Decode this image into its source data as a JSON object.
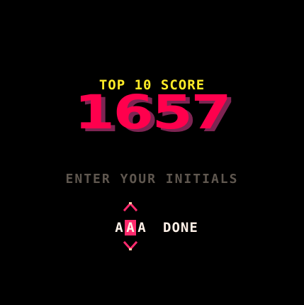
{
  "colors": {
    "background": "#000000",
    "title_yellow": "#ffec27",
    "score_pink": "#ff004d",
    "score_shadow": "#7e2553",
    "score_highlight": "#ffccaa",
    "prompt_gray": "#5f574f",
    "white": "#fff1e8",
    "cursor_pink": "#ff2a6d"
  },
  "header": {
    "subtitle": "TOP 10 SCORE",
    "score": "1657"
  },
  "entry": {
    "prompt": "ENTER YOUR INITIALS",
    "initials": [
      "A",
      "A",
      "A"
    ],
    "selected_index": 1,
    "done_label": "DONE",
    "up_icon": "arrow-up-icon",
    "down_icon": "arrow-down-icon"
  }
}
